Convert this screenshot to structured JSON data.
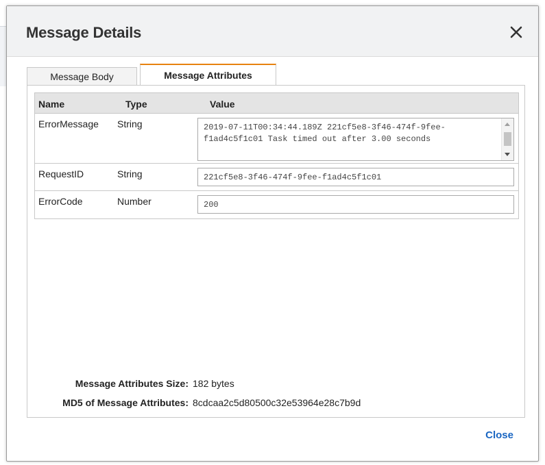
{
  "dialog": {
    "title": "Message Details",
    "close_icon": "close-icon",
    "close_label": "Close"
  },
  "tabs": [
    {
      "label": "Message Body",
      "active": false
    },
    {
      "label": "Message Attributes",
      "active": true
    }
  ],
  "table": {
    "headers": {
      "name": "Name",
      "type": "Type",
      "value": "Value"
    },
    "rows": [
      {
        "name": "ErrorMessage",
        "type": "String",
        "value": "2019-07-11T00:34:44.189Z 221cf5e8-3f46-474f-9fee-f1ad4c5f1c01 Task timed out after 3.00 seconds"
      },
      {
        "name": "RequestID",
        "type": "String",
        "value": "221cf5e8-3f46-474f-9fee-f1ad4c5f1c01"
      },
      {
        "name": "ErrorCode",
        "type": "Number",
        "value": "200"
      }
    ]
  },
  "summary": {
    "size_label": "Message Attributes Size:",
    "size_value": "182 bytes",
    "md5_label": "MD5 of Message Attributes:",
    "md5_value": "8cdcaa2c5d80500c32e53964e28c7b9d"
  },
  "colors": {
    "accent": "#e7820f",
    "link": "#1a66c2"
  }
}
